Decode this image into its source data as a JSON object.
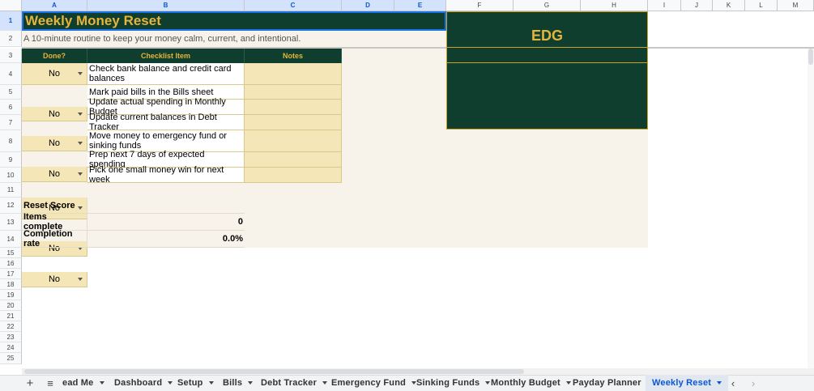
{
  "columns": [
    "A",
    "B",
    "C",
    "D",
    "E",
    "F",
    "G",
    "H",
    "I",
    "J",
    "K",
    "L",
    "M"
  ],
  "rows": [
    "1",
    "2",
    "3",
    "4",
    "5",
    "6",
    "7",
    "8",
    "9",
    "10",
    "11",
    "12",
    "13",
    "14",
    "15",
    "16",
    "17",
    "18",
    "19",
    "20",
    "21",
    "22",
    "23",
    "24",
    "25"
  ],
  "sheet": {
    "title": "Weekly Money Reset",
    "subtitle": "A 10-minute routine to keep your money calm, current, and intentional.",
    "headers": {
      "done": "Done?",
      "item": "Checklist Item",
      "notes": "Notes"
    },
    "checklist": [
      {
        "done": "No",
        "item": "Check bank balance and credit card balances",
        "notes": ""
      },
      {
        "done": "No",
        "item": "Mark paid bills in the Bills sheet",
        "notes": ""
      },
      {
        "done": "No",
        "item": "Update actual spending in Monthly Budget",
        "notes": ""
      },
      {
        "done": "No",
        "item": "Update current balances in Debt Tracker",
        "notes": ""
      },
      {
        "done": "No",
        "item": "Move money to emergency fund or sinking funds",
        "notes": ""
      },
      {
        "done": "No",
        "item": "Prep next 7 days of expected spending",
        "notes": ""
      },
      {
        "done": "No",
        "item": "Pick one small money win for next week",
        "notes": ""
      }
    ],
    "score": {
      "heading": "Reset Score",
      "items_label": "Items complete",
      "items_value": "0",
      "rate_label": "Completion rate",
      "rate_value": "0.0%"
    },
    "logo_text": "EDG"
  },
  "tabs": [
    "ead Me",
    "Dashboard",
    "Setup",
    "Bills",
    "Debt Tracker",
    "Emergency Fund",
    "Sinking Funds",
    "Monthly Budget",
    "Payday Planner",
    "Weekly Reset"
  ],
  "active_tab": "Weekly Reset",
  "icons": {
    "add": "plus-icon",
    "menu": "all-sheets-icon",
    "prev": "chevron-left-icon",
    "next": "chevron-right-icon"
  },
  "colors": {
    "dark_green": "#0f3d2e",
    "gold": "#e6b43a",
    "beige": "#f5e6b8",
    "selection": "#1a73e8"
  }
}
